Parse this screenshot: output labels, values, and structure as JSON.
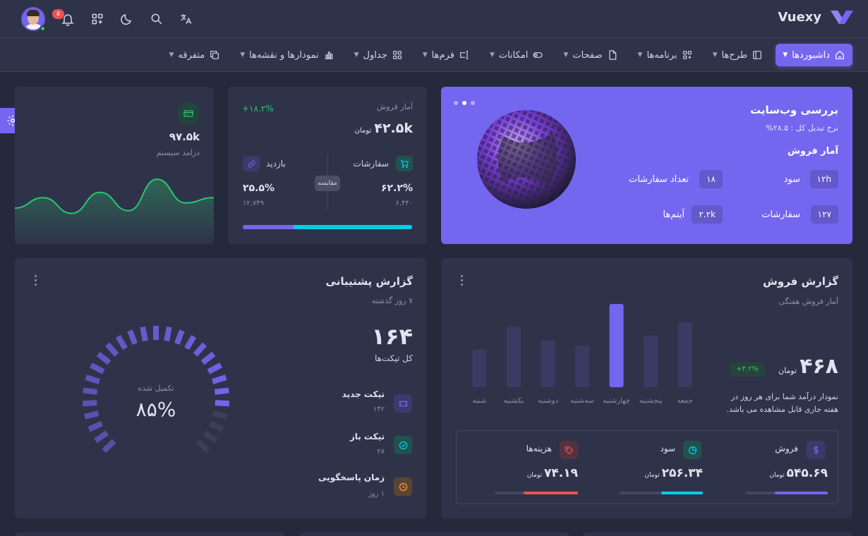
{
  "brand": {
    "name": "Vuexy",
    "accent": "#7367f0"
  },
  "topbar": {
    "notification_count": "۵"
  },
  "nav": [
    {
      "label": "داشبوردها",
      "icon": "home-icon",
      "active": true
    },
    {
      "label": "طرح‌ها",
      "icon": "layout-icon"
    },
    {
      "label": "برنامه‌ها",
      "icon": "apps-icon"
    },
    {
      "label": "صفحات",
      "icon": "file-icon"
    },
    {
      "label": "امکانات",
      "icon": "toggle-icon"
    },
    {
      "label": "فرم‌ها",
      "icon": "forms-icon"
    },
    {
      "label": "جداول",
      "icon": "table-icon"
    },
    {
      "label": "نمودارها و نقشه‌ها",
      "icon": "chart-icon"
    },
    {
      "label": "متفرقه",
      "icon": "copy-icon"
    }
  ],
  "analytics": {
    "title": "بررسی وب‌سایت",
    "subtitle": "نرخ تبدیل کل : ۲۸.۵%",
    "section": "آمار فروش",
    "items": [
      {
        "value": "۱۲h",
        "label": "سود"
      },
      {
        "value": "۱۸",
        "label": "تعداد سفارشات"
      },
      {
        "value": "۱۲۷",
        "label": "سفارشات"
      },
      {
        "value": "۲.۲k",
        "label": "آیتم‌ها"
      }
    ]
  },
  "sales_overview": {
    "title": "آمار فروش",
    "value": "۴۲.۵k",
    "currency": "تومان",
    "growth": "+۱۸.۲%",
    "orders_label": "سفارشات",
    "orders_percent": "۶۲.۲%",
    "orders_count": "۶,۴۴۰",
    "visits_label": "بازدید",
    "visits_percent": "۲۵.۵%",
    "visits_count": "۱۲,۷۴۹",
    "compare_label": "مقایسه",
    "orders_share": 0.7
  },
  "revenue": {
    "value": "۹۷.۵k",
    "label": "درامد سیستم",
    "trend": [
      22,
      30,
      18,
      34,
      20,
      44,
      26,
      30
    ]
  },
  "support": {
    "title": "گزارش پشتیبانی",
    "subtitle": "۷ روز گذشته",
    "total": "۱۶۴",
    "total_label": "کل تیکت‌ها",
    "items": [
      {
        "title": "تیکت جدید",
        "value": "۱۴۲",
        "color": "#7367f0",
        "icon": "ticket-icon"
      },
      {
        "title": "تیکت باز",
        "value": "۲۸",
        "color": "#00cfe8",
        "icon": "check-circle-icon"
      },
      {
        "title": "زمان پاسخگویی",
        "value": "۱ روز",
        "color": "#ff9f43",
        "icon": "clock-icon"
      }
    ],
    "gauge_label": "تکمیل شده",
    "gauge_value": "۸۵%",
    "gauge_fraction": 0.85
  },
  "sales_report": {
    "title": "گزارش فروش",
    "subtitle": "آمار فروش هفتگی",
    "value": "۴۶۸",
    "currency": "تومان",
    "growth": "+۴.۲%",
    "description": "نمودار درآمد شما برای هر روز در هفته جاری قابل مشاهده می باشد.",
    "chart_data": {
      "type": "bar",
      "categories": [
        "جمعه",
        "پنجشنبه",
        "چهارشنبه",
        "سه‌شنبه",
        "دوشنبه",
        "یکشنبه",
        "شنبه"
      ],
      "values": [
        0.78,
        0.62,
        1.0,
        0.5,
        0.56,
        0.73,
        0.45
      ],
      "highlight_index": 2
    },
    "stats": [
      {
        "label": "فروش",
        "value": "۵۴۵.۶۹",
        "color": "#7367f0",
        "icon": "dollar-icon",
        "fill": 0.65
      },
      {
        "label": "سود",
        "value": "۲۵۶.۳۴",
        "color": "#00cfe8",
        "icon": "pie-icon",
        "fill": 0.5
      },
      {
        "label": "هزینه‌ها",
        "value": "۷۴.۱۹",
        "color": "#ea5455",
        "icon": "tag-icon",
        "fill": 0.65
      }
    ]
  }
}
